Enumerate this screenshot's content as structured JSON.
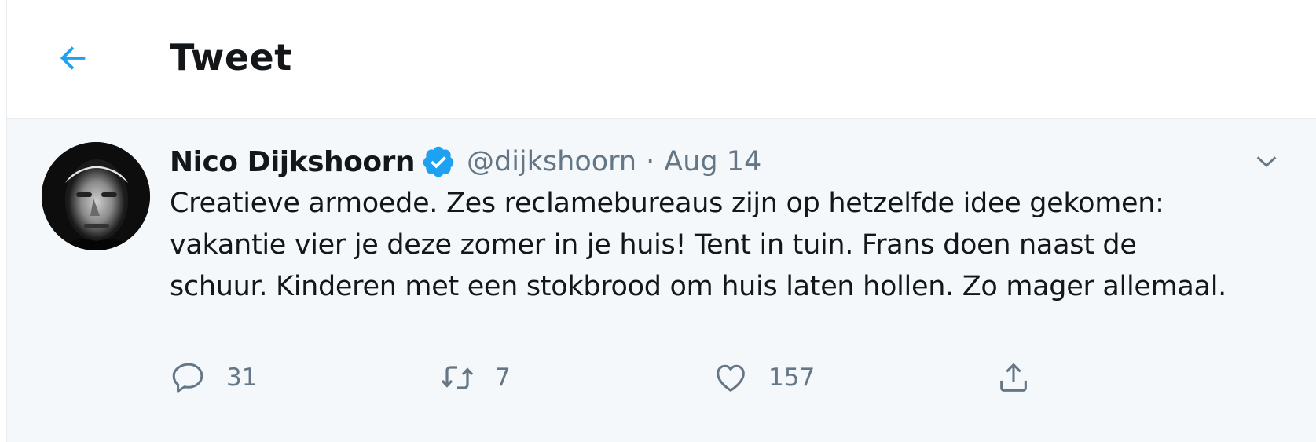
{
  "header": {
    "back_icon": "arrow-left-icon",
    "title": "Tweet"
  },
  "tweet": {
    "author": {
      "name": "Nico Dijkshoorn",
      "verified_icon": "verified-badge-icon",
      "handle": "@dijkshoorn",
      "separator": "·",
      "date": "Aug 14"
    },
    "text": "Creatieve armoede. Zes reclamebureaus zijn op hetzelfde idee gekomen: vakantie vier je deze zomer in je huis! Tent in tuin. Frans doen naast de schuur. Kinderen met een stokbrood om huis laten hollen. Zo mager allemaal.",
    "menu_icon": "chevron-down-icon",
    "actions": {
      "reply": {
        "icon": "reply-icon",
        "count": "31"
      },
      "retweet": {
        "icon": "retweet-icon",
        "count": "7"
      },
      "like": {
        "icon": "heart-icon",
        "count": "157"
      },
      "share": {
        "icon": "share-icon"
      }
    }
  },
  "colors": {
    "accent": "#1da1f2",
    "text_primary": "#14171a",
    "text_secondary": "#657786",
    "tweet_background": "#f5f8fa",
    "border": "#e6ecf0"
  }
}
